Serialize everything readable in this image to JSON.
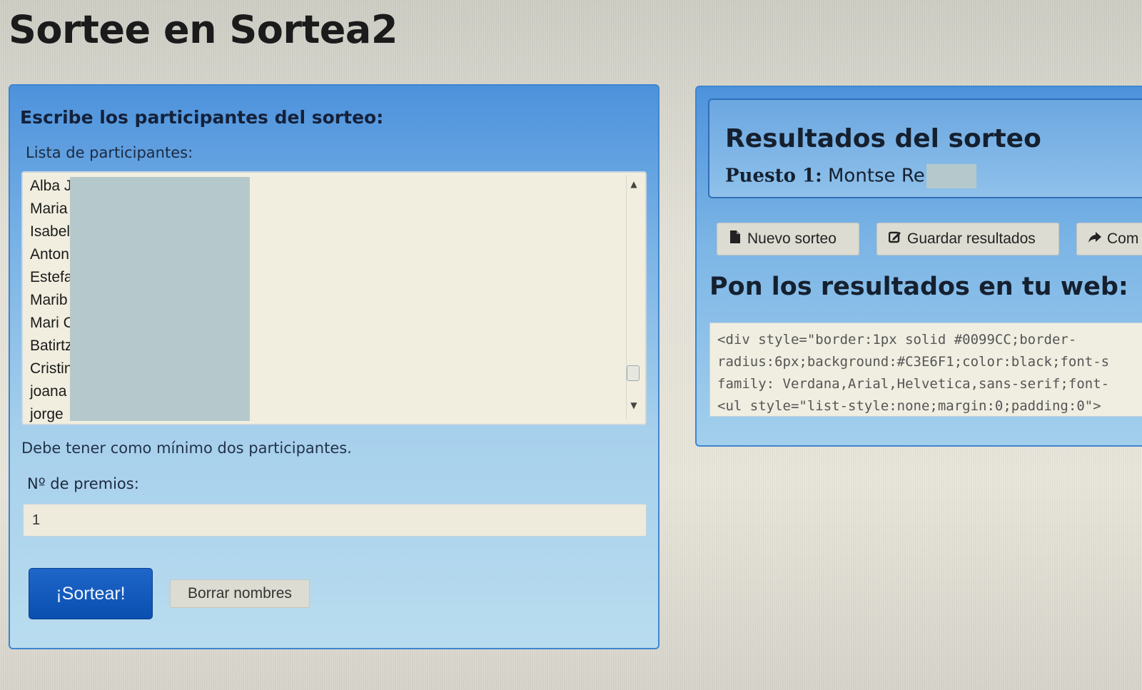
{
  "header": {
    "title": "Sortee en Sortea2"
  },
  "left_panel": {
    "heading": "Escribe los participantes del sorteo:",
    "list_label": "Lista de participantes:",
    "participants": [
      "Alba J",
      "Maria",
      "Isabel",
      "Anton",
      "Estefa",
      "Marib",
      "Mari C",
      "Batirtz",
      "Cristin",
      "joana",
      "jorge"
    ],
    "min_note": "Debe tener como mínimo dos participantes.",
    "prizes_label": "Nº de premios:",
    "prizes_value": "1",
    "draw_button": "¡Sortear!",
    "clear_button": "Borrar nombres"
  },
  "right_panel": {
    "results_title": "Resultados del sorteo",
    "result_rank": "Puesto 1:",
    "result_winner": "Montse Re",
    "buttons": {
      "new_draw": "Nuevo sorteo",
      "save_results": "Guardar resultados",
      "share": "Com"
    },
    "embed_heading": "Pon los resultados en tu web:",
    "embed_code_lines": [
      "<div style=\"border:1px solid #0099CC;border-",
      "radius:6px;background:#C3E6F1;color:black;font-s",
      "family: Verdana,Arial,Helvetica,sans-serif;font-",
      "<ul style=\"list-style:none;margin:0;padding:0\">"
    ]
  },
  "colors": {
    "panel_blue": "#4d92dc",
    "panel_border": "#3f86cf",
    "primary_button": "#0a4fb0",
    "input_background": "#f1eedf"
  },
  "icons": {
    "new_draw": "file-icon",
    "save_results": "edit-icon",
    "share": "share-arrow-icon"
  }
}
